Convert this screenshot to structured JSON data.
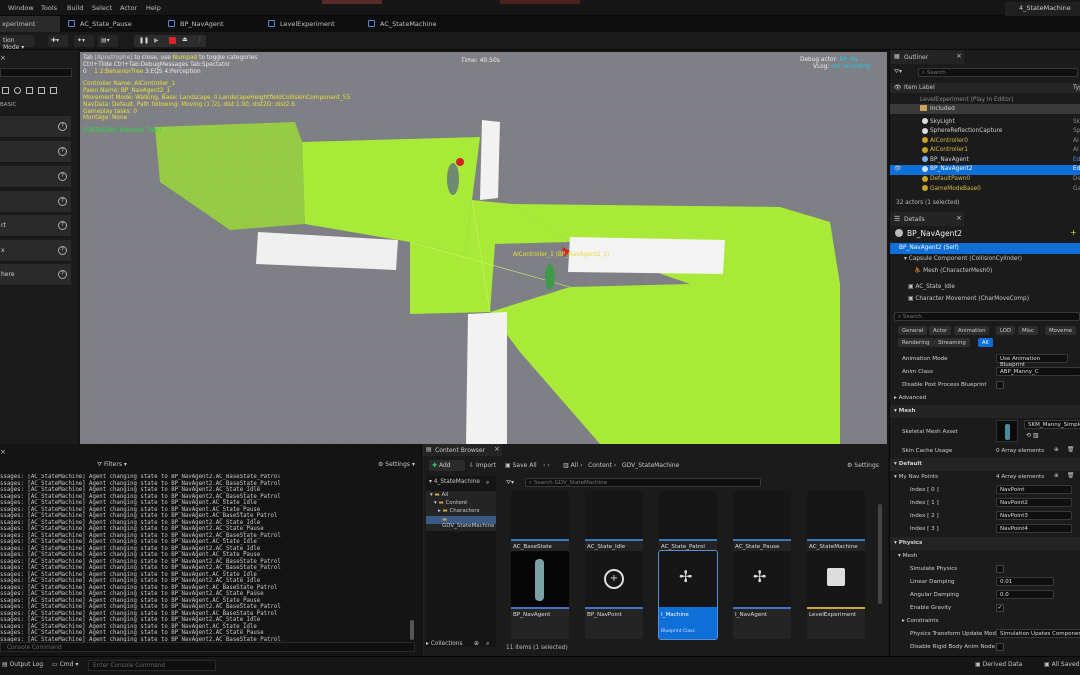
{
  "menubar": {
    "items": [
      "Window",
      "Tools",
      "Build",
      "Select",
      "Actor",
      "Help"
    ],
    "right_tab": "4_StateMachine"
  },
  "tabs": [
    {
      "label": "xperiment"
    },
    {
      "label": "AC_State_Pause"
    },
    {
      "label": "BP_NavAgent"
    },
    {
      "label": "LevelExperiment"
    },
    {
      "label": "AC_StateMachine"
    }
  ],
  "toolbar": {
    "mode": "tion Mode"
  },
  "leftpanel": {
    "section": "BASIC",
    "rows": [
      "",
      "",
      "",
      "",
      "rt",
      "x",
      "here"
    ]
  },
  "viewport": {
    "hint_line1_a": "Tab",
    "hint_line1_b": "to close, use",
    "hint_line1_c": "Numpad",
    "hint_line1_d": "to toggle categories",
    "hint_line2": "Ctrl+Tilde   Ctrl+Tab:DebugMessages Tab:Spectator",
    "hint_line3_a": "0",
    "hint_line3_b": "1",
    "hint_line3_c": "2:BehaviorTree",
    "hint_line3_d": "3:EQS",
    "hint_line3_e": "4:Perception",
    "info": [
      "Controller Name: AIController_1",
      "Pawn Name: BP_NavAgent2_1",
      "Movement Mode: Walking, Base: Landscape_0.LandscapeHeightfieldCollisionComponent_55",
      "NavData: Default, Path following: Moving (1 /2), dist:1.00, dist2D:  dist2.6",
      "Gameplay tasks: 0",
      "Montage: None"
    ],
    "category": "[CATEGORY: Behavior Tree]",
    "time": "Time: 40.50s",
    "debug_actor_label": "Debug actor:",
    "debug_actor_value": "BP_Na...",
    "vlog_label": "VLog:",
    "vlog_value": "not recording",
    "agent_label": "AIController_1 (BP_NavAgent2_1)"
  },
  "outliner": {
    "title": "Outliner",
    "search_placeholder": "Search",
    "col_label": "Item Label",
    "col_type": "Typ",
    "rows": [
      {
        "name": "LevelExperiment (Play In Editor)",
        "type": ""
      },
      {
        "name": "Included",
        "type": ""
      },
      {
        "name": "SkyLight",
        "type": "Sk"
      },
      {
        "name": "SphereReflectionCapture",
        "type": "Sp"
      },
      {
        "name": "AIController0",
        "type": "AI"
      },
      {
        "name": "AIController1",
        "type": "AI"
      },
      {
        "name": "BP_NavAgent",
        "type": "Ed"
      },
      {
        "name": "BP_NavAgent2",
        "type": "Ed"
      },
      {
        "name": "DefaultPawn0",
        "type": "De"
      },
      {
        "name": "GameModeBase0",
        "type": "Ga"
      }
    ],
    "footer": "32 actors (1 selected)"
  },
  "details": {
    "title": "Details",
    "actor": "BP_NavAgent2",
    "self": "BP_NavAgent2 (Self)",
    "capsule": "Capsule Component (CollisionCylinder)",
    "mesh": "Mesh (CharacterMesh0)",
    "ac_idle": "AC_State_Idle",
    "charmove": "Character Movement (CharMoveComp)",
    "search_placeholder": "Search",
    "filters": [
      "General",
      "Actor",
      "Animation",
      "LOD",
      "Misc",
      "Moveme"
    ],
    "filters2": [
      "Rendering",
      "Streaming",
      "All"
    ],
    "anim_mode_label": "Animation Mode",
    "anim_mode_value": "Use Animation Blueprint",
    "anim_class_label": "Anim Class",
    "anim_class_value": "ABP_Manny_C",
    "disable_pp": "Disable Post Process Blueprint",
    "advanced": "Advanced",
    "mesh_section": "Mesh",
    "skel_label": "Skeletal Mesh Asset",
    "skel_value": "SKM_Manny_Simple",
    "skin_label": "Skin Cache Usage",
    "skin_value": "0 Array elements",
    "default_section": "Default",
    "nav_points_label": "My Nav Points",
    "nav_points_value": "4 Array elements",
    "idx": [
      {
        "label": "Index [ 0 ]",
        "value": "NavPoint"
      },
      {
        "label": "Index [ 1 ]",
        "value": "NavPoint2"
      },
      {
        "label": "Index [ 2 ]",
        "value": "NavPoint3"
      },
      {
        "label": "Index [ 3 ]",
        "value": "NavPoint4"
      }
    ],
    "physics_section": "Physics",
    "mesh_sub": "Mesh",
    "sim_label": "Simulate Physics",
    "lin_label": "Linear Damping",
    "lin_value": "0.01",
    "ang_label": "Angular Damping",
    "ang_value": "0.0",
    "grav_label": "Enable Gravity",
    "constraints": "Constraints",
    "pt_label": "Physics Transform Update Mode",
    "pt_value": "Simulation Upates Component Tra",
    "drb_label": "Disable Rigid Body Anim Node"
  },
  "outputlog": {
    "filters": "Filters",
    "settings": "Settings",
    "lines": [
      "ssages: [AC_StateMachine] Agent changing state to BP_NavAgent2.AC_BaseState_Patrol",
      "ssages: [AC_StateMachine] Agent changing state to BP_NavAgent2.AC_BaseState_Patrol",
      "ssages: [AC_StateMachine] Agent changing state to BP_NavAgent2.AC_State_Idle",
      "ssages: [AC_StateMachine] Agent changing state to BP_NavAgent2.AC_BaseState_Patrol",
      "ssages: [AC_StateMachine] Agent changing state to BP_NavAgent.AC_State_Idle",
      "ssages: [AC_StateMachine] Agent changing state to BP_NavAgent.AC_State_Pause",
      "ssages: [AC_StateMachine] Agent changing state to BP_NavAgent.AC_BaseState_Patrol",
      "ssages: [AC_StateMachine] Agent changing state to BP_NavAgent2.AC_State_Idle",
      "ssages: [AC_StateMachine] Agent changing state to BP_NavAgent2.AC_State_Pause",
      "ssages: [AC_StateMachine] Agent changing state to BP_NavAgent2.AC_BaseState_Patrol",
      "ssages: [AC_StateMachine] Agent changing state to BP_NavAgent.AC_State_Idle",
      "ssages: [AC_StateMachine] Agent changing state to BP_NavAgent2.AC_State_Idle",
      "ssages: [AC_StateMachine] Agent changing state to BP_NavAgent.AC_State_Pause",
      "ssages: [AC_StateMachine] Agent changing state to BP_NavAgent2.AC_BaseState_Patrol",
      "ssages: [AC_StateMachine] Agent changing state to BP_NavAgent2.AC_BaseState_Patrol",
      "ssages: [AC_StateMachine] Agent changing state to BP_NavAgent.AC_State_Idle",
      "ssages: [AC_StateMachine] Agent changing state to BP_NavAgent2.AC_State_Idle",
      "ssages: [AC_StateMachine] Agent changing state to BP_NavAgent.AC_BaseState_Patrol",
      "ssages: [AC_StateMachine] Agent changing state to BP_NavAgent2.AC_State_Pause",
      "ssages: [AC_StateMachine] Agent changing state to BP_NavAgent.AC_State_Pause",
      "ssages: [AC_StateMachine] Agent changing state to BP_NavAgent2.AC_BaseState_Patrol",
      "ssages: [AC_StateMachine] Agent changing state to BP_NavAgent.AC_BaseState_Patrol",
      "ssages: [AC_StateMachine] Agent changing state to BP_NavAgent2.AC_State_Idle",
      "ssages: [AC_StateMachine] Agent changing state to BP_NavAgent.AC_State_Idle",
      "ssages: [AC_StateMachine] Agent changing state to BP_NavAgent2.AC_State_Pause",
      "ssages: [AC_StateMachine] Agent changing state to BP_NavAgent2.AC_BaseState_Patrol"
    ],
    "console_placeholder": "Console Command"
  },
  "contentbrowser": {
    "title": "Content Browser",
    "add": "Add",
    "import": "Import",
    "save_all": "Save All",
    "crumbs": [
      "All",
      "Content",
      "GDV_StateMachine"
    ],
    "settings": "Settings",
    "tree_title": "4_StateMachine",
    "tree": [
      "All",
      "Content",
      "Characters",
      "GDV_StateMachine"
    ],
    "search_placeholder": "Search GDV_StateMachine",
    "assets_row1": [
      {
        "name": "AC_BaseState",
        "type": "Blueprint Class"
      },
      {
        "name": "AC_State_Idle",
        "type": "Blueprint Class"
      },
      {
        "name": "AC_State_Patrol",
        "type": "Blueprint Class"
      },
      {
        "name": "AC_State_Pause",
        "type": "Blueprint Class"
      },
      {
        "name": "AC_StateMachine",
        "type": "Blueprint Class"
      }
    ],
    "assets_row2": [
      {
        "name": "BP_NavAgent",
        "type": ""
      },
      {
        "name": "BP_NavPoint",
        "type": ""
      },
      {
        "name": "I_Machine",
        "type": "Blueprint Class"
      },
      {
        "name": "I_NavAgent",
        "type": ""
      },
      {
        "name": "LevelExperiment",
        "type": ""
      }
    ],
    "collections": "Collections",
    "footer": "11 items (1 selected)"
  },
  "statusbar": {
    "output_log": "Output Log",
    "cmd": "Cmd",
    "console_placeholder": "Enter Console Command",
    "derived": "Derived Data",
    "saved": "All Saved"
  },
  "colors": {
    "accent": "#0e6fd8",
    "ground": "#a8ea37",
    "blueprint_bar": "#3a78c4"
  }
}
